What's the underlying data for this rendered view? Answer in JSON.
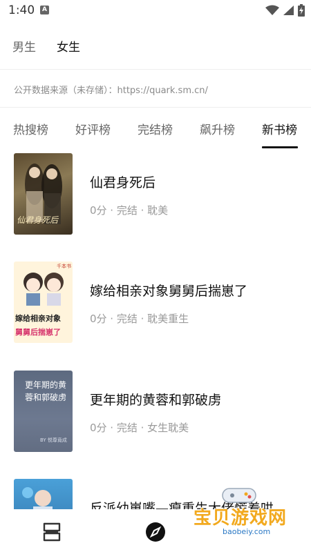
{
  "status_bar": {
    "time": "1:40",
    "notification_letter": "A",
    "icons": [
      "wifi-icon",
      "signal-icon",
      "battery-charging-icon"
    ]
  },
  "gender_tabs": [
    {
      "label": "男生",
      "active": false
    },
    {
      "label": "女生",
      "active": true
    }
  ],
  "data_source": "公开数据来源（未存储）：https://quark.sm.cn/",
  "rank_tabs": [
    {
      "label": "热搜榜",
      "active": false
    },
    {
      "label": "好评榜",
      "active": false
    },
    {
      "label": "完结榜",
      "active": false
    },
    {
      "label": "飙升榜",
      "active": false
    },
    {
      "label": "新书榜",
      "active": true
    }
  ],
  "books": [
    {
      "title": "仙君身死后",
      "meta": "0分 · 完结 · 耽美",
      "cover": {
        "text": "仙君身死后"
      }
    },
    {
      "title": "嫁给相亲对象舅舅后揣崽了",
      "meta": "0分 · 完结 · 耽美重生",
      "cover": {
        "text_top": "嫁给相亲对象",
        "text_bottom": "舅舅后揣崽了",
        "badge": "千本书"
      }
    },
    {
      "title": "更年期的黄蓉和郭破虏",
      "meta": "0分 · 完结 · 女生耽美",
      "cover": {
        "text_line1": "更年期的黄",
        "text_line2": "蓉和郭破虏",
        "author": "BY 悦尊竟成"
      }
    },
    {
      "title": "反派幼崽嘴—瘪重生大佬慌着哄",
      "meta": "",
      "cover": {}
    }
  ],
  "bottom_nav": {
    "items": [
      "bookshelf-icon",
      "discover-compass-icon"
    ]
  },
  "watermark": {
    "text": "宝贝游戏网",
    "url": "baobeiy.com"
  },
  "colors": {
    "active_text": "#111111",
    "inactive_text": "#666666",
    "meta_text": "#9a9a9a",
    "watermark_orange": "#f2a91e"
  }
}
